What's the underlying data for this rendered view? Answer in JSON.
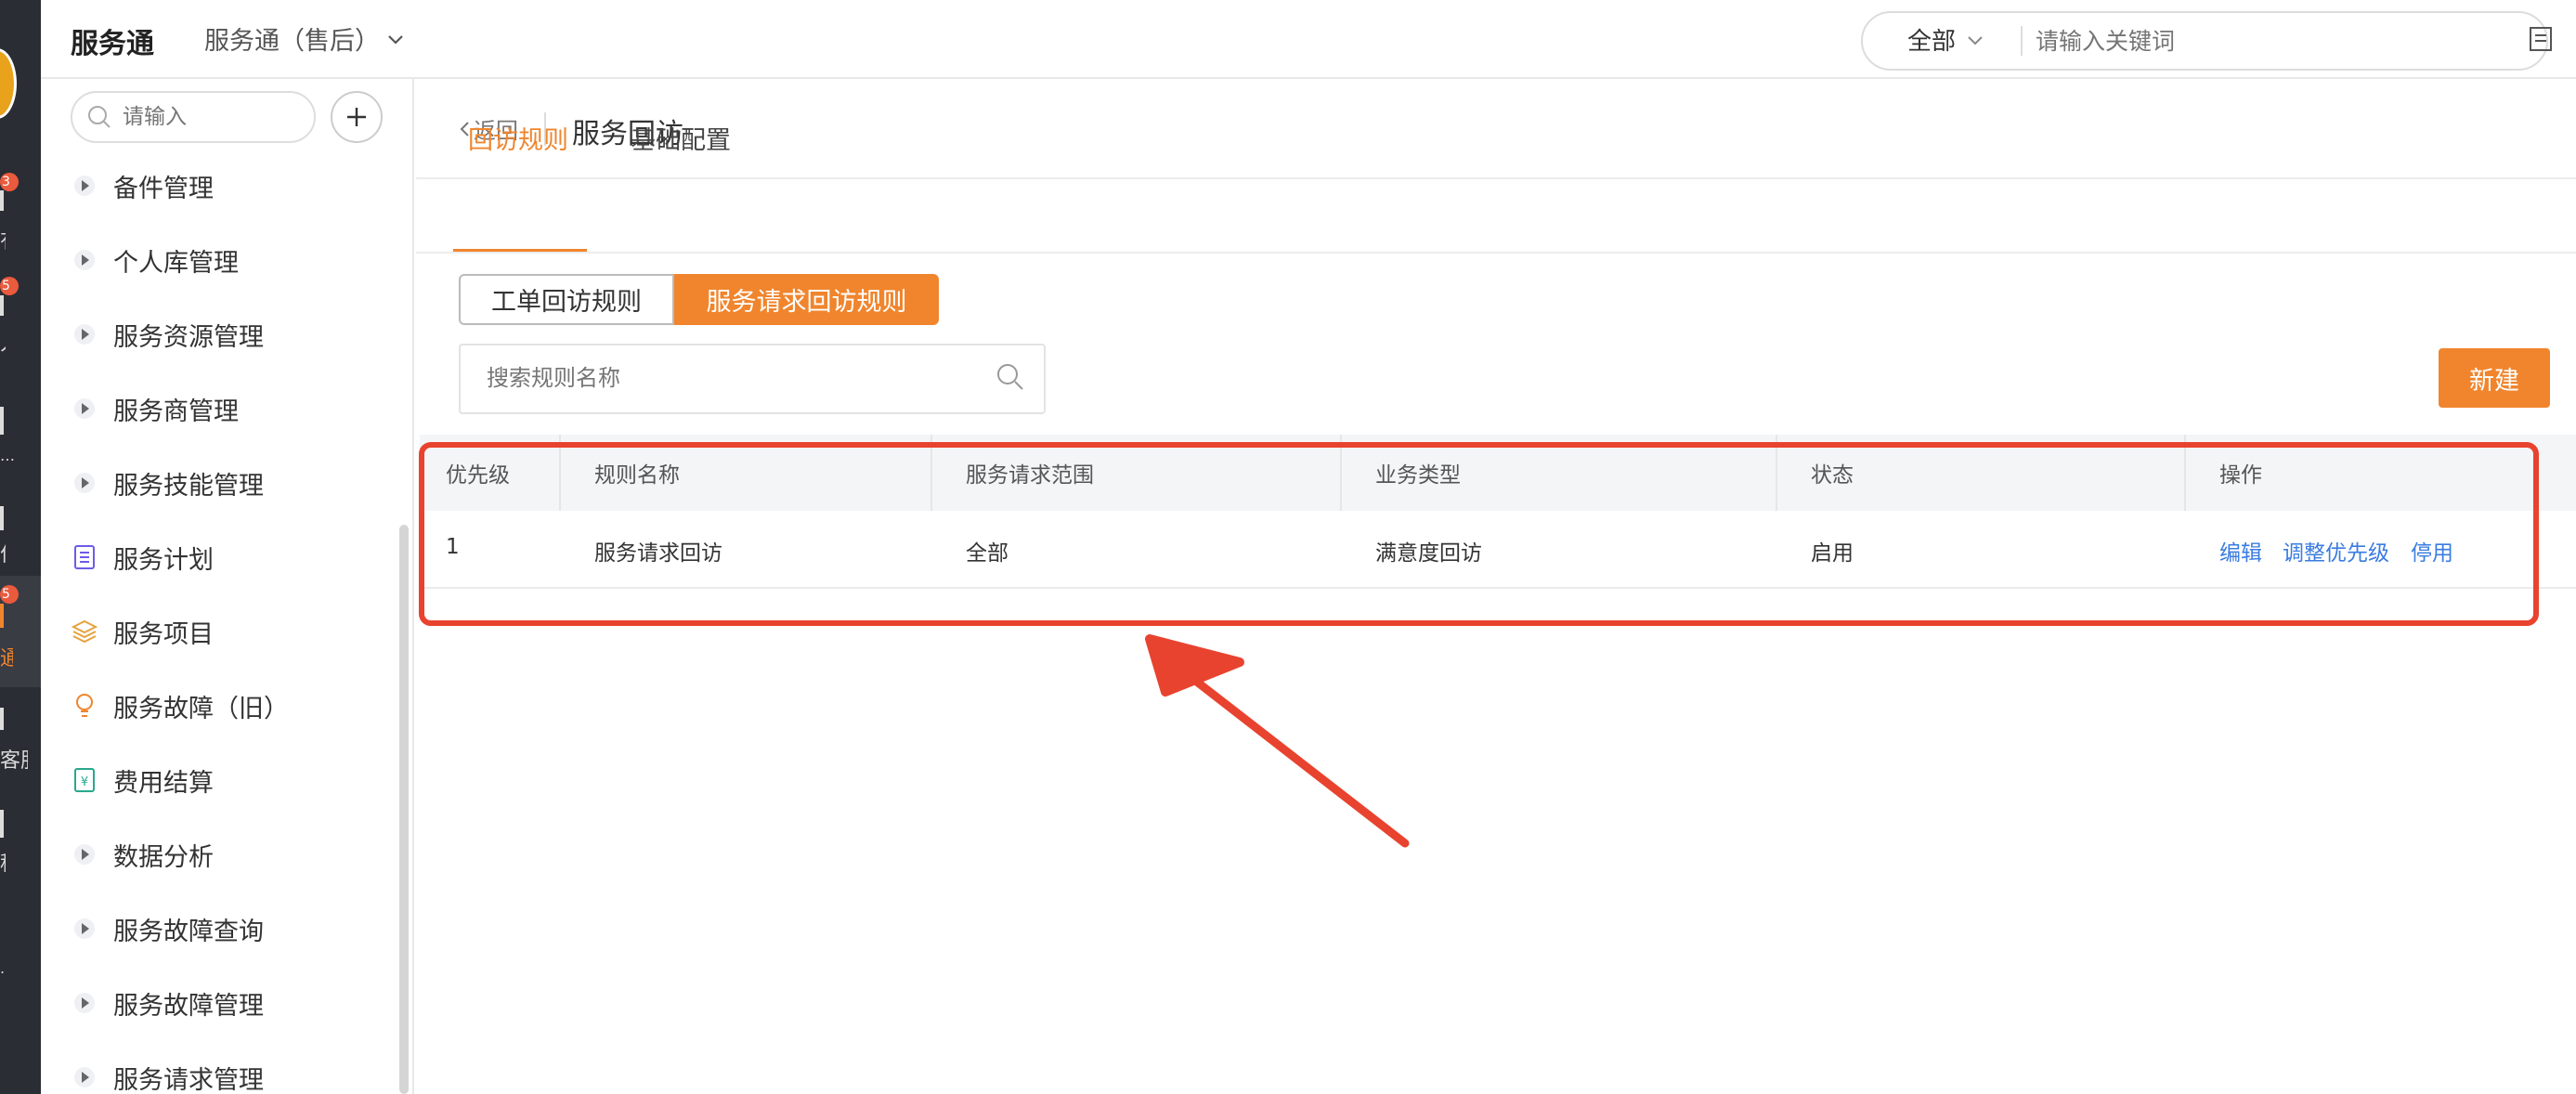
{
  "rail": {
    "badges": [
      "3",
      "5",
      "5"
    ],
    "texts": [
      "有",
      "人",
      "…",
      "作",
      "通",
      "客服",
      "程"
    ]
  },
  "header": {
    "app_title": "服务通",
    "app_switch": "服务通（售后）",
    "scope_select": "全部",
    "search_placeholder": "请输入关键词"
  },
  "sidebar": {
    "search_placeholder": "请输入",
    "items": [
      {
        "label": "备件管理",
        "icon": "triangle-icon"
      },
      {
        "label": "个人库管理",
        "icon": "triangle-icon"
      },
      {
        "label": "服务资源管理",
        "icon": "triangle-icon"
      },
      {
        "label": "服务商管理",
        "icon": "triangle-icon"
      },
      {
        "label": "服务技能管理",
        "icon": "triangle-icon"
      },
      {
        "label": "服务计划",
        "icon": "checklist-icon"
      },
      {
        "label": "服务项目",
        "icon": "layers-icon"
      },
      {
        "label": "服务故障（旧）",
        "icon": "bulb-icon"
      },
      {
        "label": "费用结算",
        "icon": "yen-doc-icon"
      },
      {
        "label": "数据分析",
        "icon": "triangle-icon"
      },
      {
        "label": "服务故障查询",
        "icon": "triangle-icon"
      },
      {
        "label": "服务故障管理",
        "icon": "triangle-icon"
      },
      {
        "label": "服务请求管理",
        "icon": "triangle-icon"
      }
    ]
  },
  "main": {
    "back_label": "返回",
    "page_title": "服务回访",
    "tabs": [
      "回访规则",
      "基础配置"
    ],
    "segments": [
      "工单回访规则",
      "服务请求回访规则"
    ],
    "rule_search_placeholder": "搜索规则名称",
    "new_button": "新建",
    "table": {
      "headers": [
        "优先级",
        "规则名称",
        "服务请求范围",
        "业务类型",
        "状态",
        "操作"
      ],
      "rows": [
        {
          "priority": "1",
          "name": "服务请求回访",
          "scope": "全部",
          "type": "满意度回访",
          "status": "启用",
          "actions": [
            "编辑",
            "调整优先级",
            "停用"
          ]
        }
      ]
    }
  },
  "colors": {
    "accent": "#f0852d",
    "link": "#3a7ce0",
    "annotation": "#e8432f",
    "rail": "#2b2d34"
  }
}
